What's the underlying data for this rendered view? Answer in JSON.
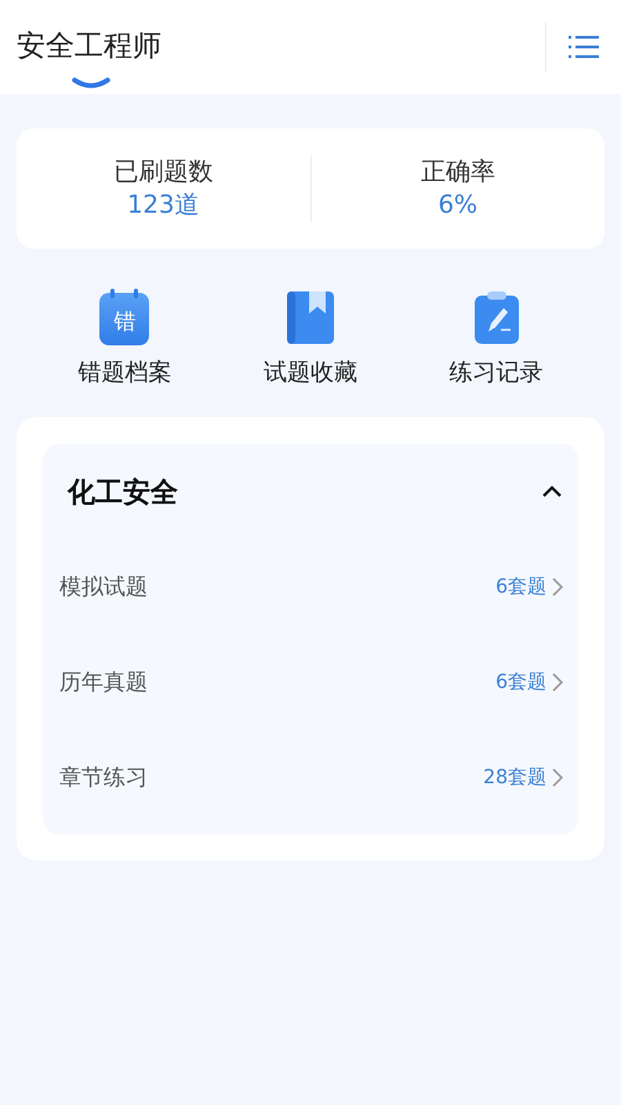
{
  "header": {
    "tabs": [
      {
        "label": "安全工程师",
        "selected": true
      }
    ]
  },
  "stats": [
    {
      "label": "已刷题数",
      "value": "123道"
    },
    {
      "label": "正确率",
      "value": "6%"
    }
  ],
  "shortcuts": [
    {
      "kind": "mistakes",
      "icon_text": "错",
      "label": "错题档案"
    },
    {
      "kind": "bookmark",
      "label": "试题收藏"
    },
    {
      "kind": "record",
      "label": "练习记录"
    }
  ],
  "section": {
    "title": "化工安全",
    "expanded": true,
    "items": [
      {
        "label": "模拟试题",
        "count": "6套题"
      },
      {
        "label": "历年真题",
        "count": "6套题"
      },
      {
        "label": "章节练习",
        "count": "28套题"
      }
    ]
  }
}
